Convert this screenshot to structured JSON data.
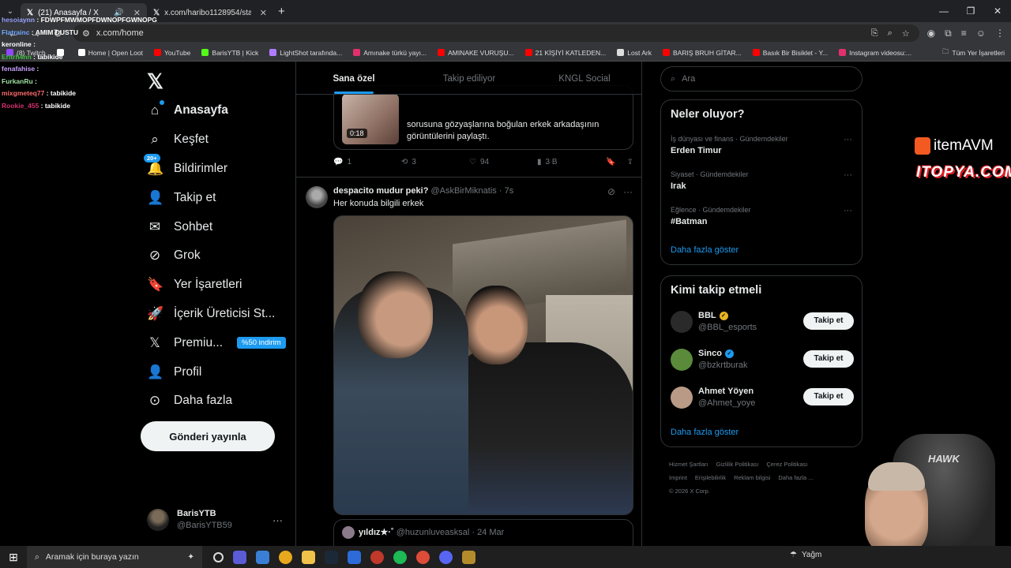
{
  "browser": {
    "tabs": [
      {
        "title": "(21) Anasayfa / X",
        "active": true
      },
      {
        "title": "x.com/haribo1128954/status/2",
        "active": false
      }
    ],
    "url": "x.com/home",
    "bookmarks": [
      {
        "label": "(8) Twitch",
        "color": "#9146ff"
      },
      {
        "label": "",
        "color": "#ffffff"
      },
      {
        "label": "Home | Open Loot",
        "color": "#ffffff"
      },
      {
        "label": "YouTube",
        "color": "#ff0000"
      },
      {
        "label": "BarisYTB | Kick",
        "color": "#53fc18"
      },
      {
        "label": "LightShot tarafında...",
        "color": "#b07cff"
      },
      {
        "label": "Amınake türkü yayı...",
        "color": "#e1306c"
      },
      {
        "label": "AMINAKE VURUŞU...",
        "color": "#ff0000"
      },
      {
        "label": "21 KİŞİYİ KATLEDEN...",
        "color": "#ff0000"
      },
      {
        "label": "Lost Ark",
        "color": "#dddddd"
      },
      {
        "label": "BARIŞ BRUH GİTAR...",
        "color": "#ff0000"
      },
      {
        "label": "Basık Bir Bisiklet - Y...",
        "color": "#ff0000"
      },
      {
        "label": "Instagram videosu:...",
        "color": "#e1306c"
      }
    ],
    "all_bookmarks": "Tüm Yer İşaretleri"
  },
  "chat": [
    {
      "user": "hesoiaynn",
      "msg": "FDWPFMWMOPFDWNOPFGWNOPG",
      "color": "#9aa4ff"
    },
    {
      "user": "Flatrainc",
      "msg": "AMIM DUSTU",
      "color": "#6fa8ff"
    },
    {
      "user": "keronline",
      "msg": "",
      "color": "#ffffff"
    },
    {
      "user": "Eritrh4nn",
      "msg": "tabikide",
      "color": "#3fbf3f"
    },
    {
      "user": "fenafahise",
      "msg": "",
      "color": "#c8a0ff"
    },
    {
      "user": "FurkanRu",
      "msg": "",
      "color": "#a0e0a0"
    },
    {
      "user": "mixgmeteq77",
      "msg": "tabikide",
      "color": "#ff6b6b"
    },
    {
      "user": "Rookie_455",
      "msg": "tabikide",
      "color": "#d0306e"
    }
  ],
  "nav": {
    "items": [
      {
        "label": "Anasayfa",
        "icon": "home-icon",
        "glyph": "⌂"
      },
      {
        "label": "Keşfet",
        "icon": "search-icon",
        "glyph": "⌕"
      },
      {
        "label": "Bildirimler",
        "icon": "bell-icon",
        "glyph": "🔔",
        "badge": "20+"
      },
      {
        "label": "Takip et",
        "icon": "add-person-icon",
        "glyph": "👤"
      },
      {
        "label": "Sohbet",
        "icon": "mail-icon",
        "glyph": "✉"
      },
      {
        "label": "Grok",
        "icon": "grok-icon",
        "glyph": "⊘"
      },
      {
        "label": "Yer İşaretleri",
        "icon": "bookmark-icon",
        "glyph": "🔖"
      },
      {
        "label": "İçerik Üreticisi St...",
        "icon": "rocket-icon",
        "glyph": "🚀"
      },
      {
        "label": "Premiu...",
        "icon": "x-icon",
        "glyph": "𝕏",
        "promo": "%50 indirim"
      },
      {
        "label": "Profil",
        "icon": "profile-icon",
        "glyph": "👤"
      },
      {
        "label": "Daha fazla",
        "icon": "more-circle-icon",
        "glyph": "⊙"
      }
    ],
    "post_button": "Gönderi yayınla",
    "account": {
      "name": "BarisYTB",
      "handle": "@BarisYTB59"
    }
  },
  "feed": {
    "tabs": [
      "Sana özel",
      "Takip ediliyor",
      "KNGL Social"
    ],
    "quoted": {
      "text": "sorusuna gözyaşlarına boğulan erkek arkadaşının görüntülerini paylaştı.",
      "duration": "0:18"
    },
    "actions": {
      "replies": "1",
      "reposts": "3",
      "likes": "94",
      "views": "3 B"
    },
    "tweet": {
      "name": "despacito mudur peki?",
      "handle": "@AskBirMiknatis",
      "time": "7s",
      "text": "Her konuda bilgili erkek"
    },
    "quote2": {
      "name": "yıldız★·˚",
      "handle": "@huzunluveasksal",
      "date": "24 Mar"
    }
  },
  "sidebar": {
    "search_placeholder": "Ara",
    "trends_title": "Neler oluyor?",
    "trends": [
      {
        "category": "İş dünyası ve finans · Gündemdekiler",
        "name": "Erden Timur"
      },
      {
        "category": "Siyaset · Gündemdekiler",
        "name": "Irak"
      },
      {
        "category": "Eğlence · Gündemdekiler",
        "name": "#Batman"
      }
    ],
    "more": "Daha fazla göster",
    "who_title": "Kimi takip etmeli",
    "follow": [
      {
        "name": "BBL",
        "handle": "@BBL_esports",
        "badge_color": "#e8b422",
        "avatar_color": "#2a2a2a"
      },
      {
        "name": "Sinco",
        "handle": "@bzkrtburak",
        "badge_color": "#1d9bf0",
        "avatar_color": "#5a8a3a"
      },
      {
        "name": "Ahmet Yöyen",
        "handle": "@Ahmet_yoye",
        "badge_color": "",
        "avatar_color": "#b89a86"
      }
    ],
    "follow_btn": "Takip et",
    "more2": "Daha fazla göster",
    "footer": [
      "Hizmet Şartları",
      "Gizlilik Politikası",
      "Çerez Politikası",
      "Imprint",
      "Erişilebilirlik",
      "Reklam bilgisi",
      "Daha fazla ...",
      "© 2026 X Corp."
    ]
  },
  "overlays": {
    "sponsor1": "itemAVM",
    "sponsor2": "ITOPYA.COM",
    "chair": "HAWK"
  },
  "taskbar": {
    "search": "Aramak için buraya yazın",
    "weather": "Yağm"
  }
}
